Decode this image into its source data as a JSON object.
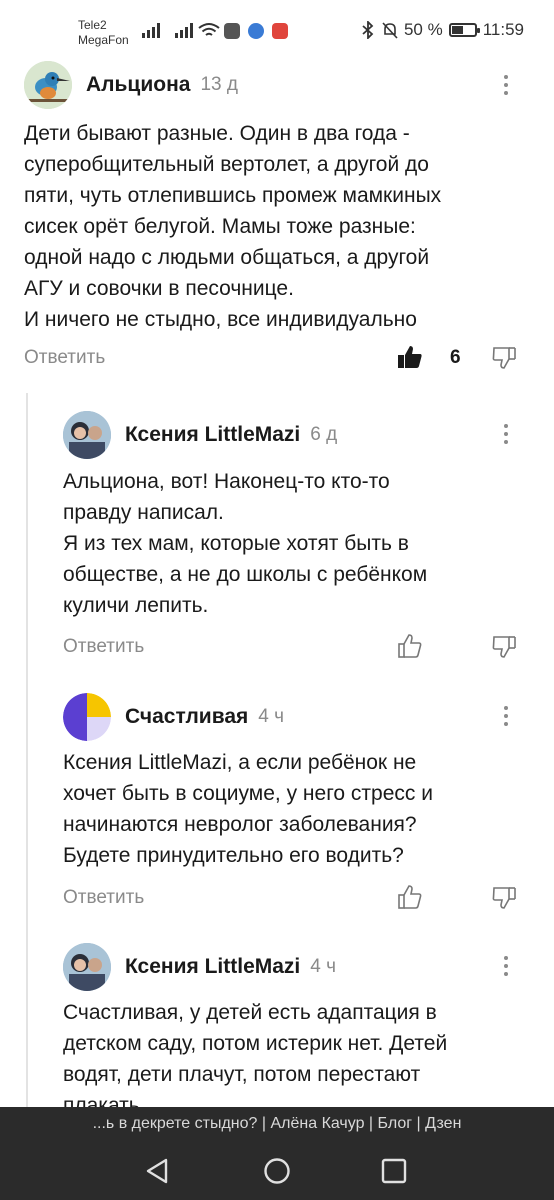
{
  "status_bar": {
    "carrier_1": "Tele2",
    "carrier_2": "MegaFon",
    "battery": "50 %",
    "battery_level": 0.5,
    "time": "11:59"
  },
  "comments": [
    {
      "author": "Альциона",
      "ago": "13 д",
      "text": "Дети бывают разные. Один в два года -\nсуперобщительный вертолет, а другой до\nпяти, чуть отлепившись промеж мамкиных\nсисек орёт белугой. Мамы тоже разные:\nодной надо с людьми общаться, а другой\nАГУ и совочки в песочнице.\nИ ничего не стыдно, все индивидуально",
      "reply_label": "Ответить",
      "likes": "6",
      "liked": true
    },
    {
      "author": "Ксения LittleMazi",
      "ago": "6 д",
      "text": "Альциона, вот! Наконец-то кто-то\nправду написал.\nЯ из тех мам, которые хотят быть в\nобществе, а не до школы с ребёнком\nкуличи лепить.",
      "reply_label": "Ответить"
    },
    {
      "author": "Счастливая",
      "ago": "4 ч",
      "text": "Ксения LittleMazi, а если ребёнок не\nхочет быть в социуме, у него стресс и\nначинаются невролог заболевания?\nБудете принудительно его водить?",
      "reply_label": "Ответить"
    },
    {
      "author": "Ксения LittleMazi",
      "ago": "4 ч",
      "text": "Счастливая, у детей есть адаптация в\nдетском саду, потом истерик нет. Детей\nводят, дети плачут, потом перестают\nплакать."
    }
  ],
  "browser": {
    "page_title": "...ь в декрете стыдно? | Алёна Качур | Блог | Дзен"
  },
  "icons": {
    "back": "back-triangle-icon",
    "home": "home-circle-icon",
    "recents": "recents-square-icon"
  },
  "colors": {
    "text": "#1a1a1a",
    "muted": "#8a8a8a",
    "thread_line": "#e3e3e3",
    "nav_bar": "#2b2b2b"
  }
}
